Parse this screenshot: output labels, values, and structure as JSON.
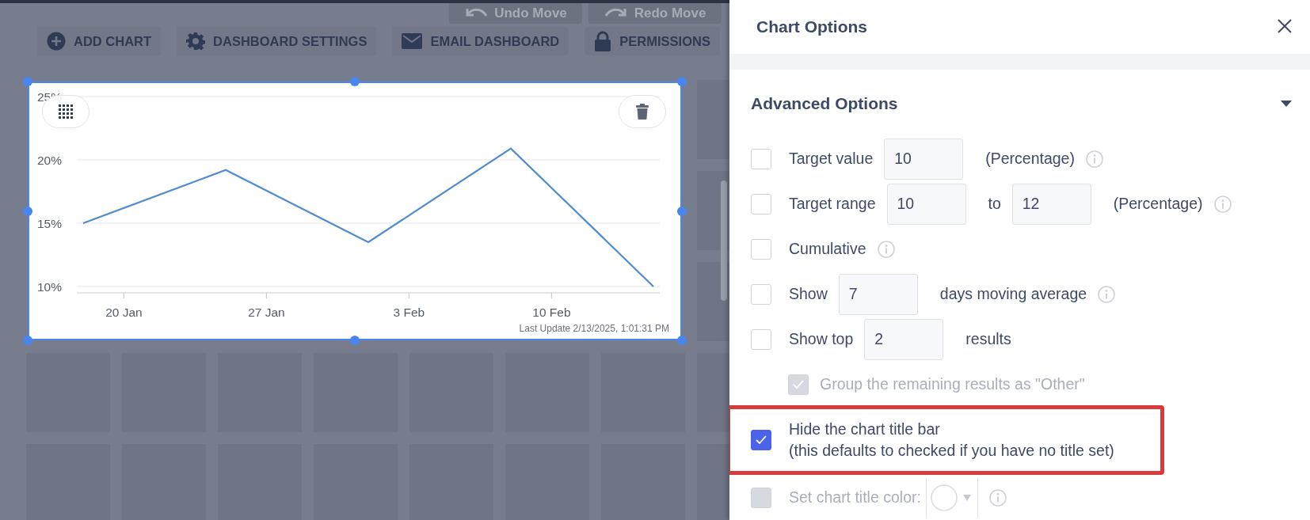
{
  "toolbar": {
    "buttons": [
      {
        "kind": "plus",
        "label": "ADD CHART"
      },
      {
        "kind": "gear",
        "label": "DASHBOARD SETTINGS"
      },
      {
        "kind": "mail",
        "label": "EMAIL DASHBOARD"
      },
      {
        "kind": "lock",
        "label": "PERMISSIONS"
      }
    ],
    "history": [
      {
        "kind": "undo",
        "label": "Undo Move"
      },
      {
        "kind": "redo",
        "label": "Redo Move"
      }
    ]
  },
  "chart_card": {
    "selected": true,
    "last_update": "Last Update 2/13/2025, 1:01:31 PM",
    "chart_data": {
      "type": "line",
      "grid": true,
      "ylim": [
        9.5,
        25
      ],
      "categories": [
        null,
        null,
        "20 Jan",
        null,
        null,
        null,
        null,
        null,
        null,
        "27 Jan",
        null,
        null,
        null,
        null,
        null,
        null,
        "3 Feb",
        null,
        null,
        null,
        null,
        null,
        null,
        "10 Feb",
        null,
        null,
        null,
        null,
        null
      ],
      "yticks": [
        {
          "value": 10,
          "label": "10%"
        },
        {
          "value": 15,
          "label": "15%"
        },
        {
          "value": 20,
          "label": "20%"
        },
        {
          "value": 25,
          "label": "25%"
        }
      ],
      "series": [
        {
          "color": "#4f8bd0",
          "values": [
            15,
            null,
            null,
            null,
            null,
            null,
            null,
            19.2,
            null,
            null,
            null,
            null,
            null,
            null,
            13.5,
            null,
            null,
            null,
            null,
            null,
            null,
            20.9,
            null,
            null,
            null,
            null,
            null,
            null,
            10
          ]
        }
      ]
    }
  },
  "panel": {
    "title": "Chart Options",
    "section": {
      "title": "Advanced Options",
      "expanded": true,
      "rows": [
        {
          "checked": false,
          "disabled": false,
          "highlighted": false,
          "parts": [
            {
              "kind": "text",
              "text": "Target value"
            },
            {
              "kind": "input",
              "value": "10"
            },
            {
              "kind": "text",
              "text": "(Percentage)"
            },
            {
              "kind": "info"
            }
          ]
        },
        {
          "checked": false,
          "disabled": false,
          "highlighted": false,
          "parts": [
            {
              "kind": "text",
              "text": "Target range"
            },
            {
              "kind": "input",
              "value": "10"
            },
            {
              "kind": "text",
              "text": "to"
            },
            {
              "kind": "input",
              "value": "12"
            },
            {
              "kind": "text",
              "text": "(Percentage)"
            },
            {
              "kind": "info"
            }
          ]
        },
        {
          "checked": false,
          "disabled": false,
          "highlighted": false,
          "parts": [
            {
              "kind": "text",
              "text": "Cumulative"
            },
            {
              "kind": "info"
            }
          ]
        },
        {
          "checked": false,
          "disabled": false,
          "highlighted": false,
          "parts": [
            {
              "kind": "text",
              "text": "Show"
            },
            {
              "kind": "input",
              "value": "7"
            },
            {
              "kind": "text",
              "text": "days moving average"
            },
            {
              "kind": "info"
            }
          ]
        },
        {
          "checked": false,
          "disabled": false,
          "highlighted": false,
          "parts": [
            {
              "kind": "text",
              "text": "Show top"
            },
            {
              "kind": "input",
              "value": "2"
            },
            {
              "kind": "text",
              "text": "results"
            }
          ],
          "children": [
            {
              "checked": true,
              "disabled": true,
              "highlighted": false,
              "parts": [
                {
                  "kind": "text",
                  "text": "Group the remaining results as \"Other\""
                }
              ]
            }
          ]
        },
        {
          "checked": true,
          "disabled": false,
          "highlighted": true,
          "parts": [
            {
              "kind": "lines",
              "lines": [
                "Hide the chart title bar",
                "(this defaults to checked if you have no title set)"
              ]
            }
          ]
        },
        {
          "checked": false,
          "disabled": true,
          "highlighted": false,
          "parts": [
            {
              "kind": "text",
              "text": "Set chart title color:"
            },
            {
              "kind": "color"
            },
            {
              "kind": "info"
            }
          ]
        }
      ]
    }
  }
}
